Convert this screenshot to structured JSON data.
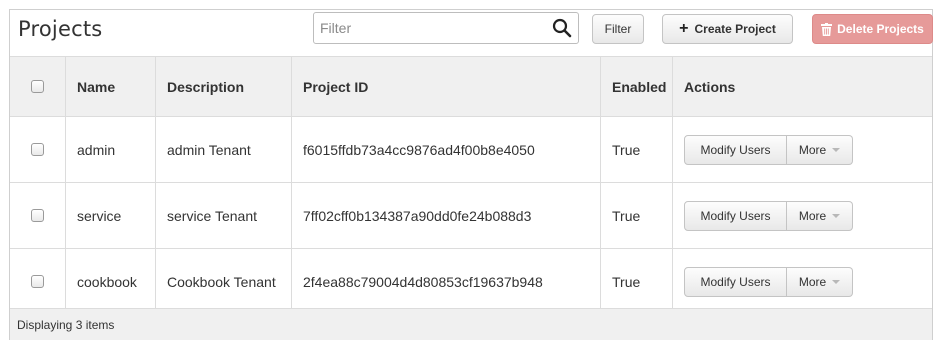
{
  "header": {
    "title": "Projects",
    "filter_placeholder": "Filter",
    "filter_button": "Filter",
    "create_button": "Create Project",
    "delete_button": "Delete Projects"
  },
  "table": {
    "columns": [
      "Name",
      "Description",
      "Project ID",
      "Enabled",
      "Actions"
    ],
    "rows": [
      {
        "name": "admin",
        "description": "admin Tenant",
        "project_id": "f6015ffdb73a4cc9876ad4f00b8e4050",
        "enabled": "True",
        "modify": "Modify Users",
        "more": "More"
      },
      {
        "name": "service",
        "description": "service Tenant",
        "project_id": "7ff02cff0b134387a90dd0fe24b088d3",
        "enabled": "True",
        "modify": "Modify Users",
        "more": "More"
      },
      {
        "name": "cookbook",
        "description": "Cookbook Tenant",
        "project_id": "2f4ea88c79004d4d80853cf19637b948",
        "enabled": "True",
        "modify": "Modify Users",
        "more": "More"
      }
    ]
  },
  "footer": {
    "status": "Displaying 3 items"
  },
  "colors": {
    "delete_button_bg": "#e69a99",
    "table_header_bg": "#f0f0f0",
    "border": "#dcdcdc"
  }
}
